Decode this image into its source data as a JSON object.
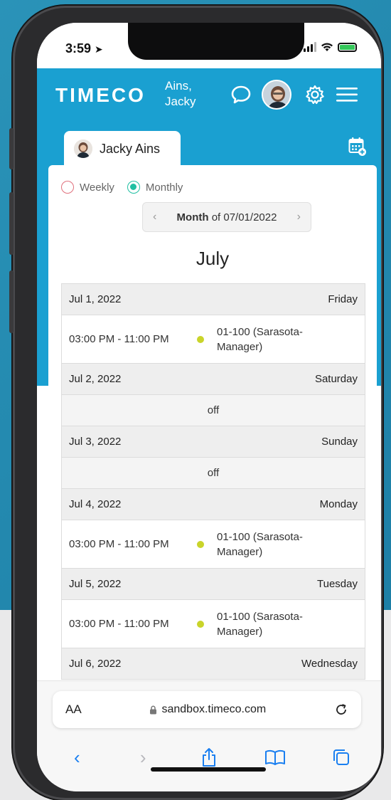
{
  "status": {
    "time": "3:59"
  },
  "header": {
    "logo": "TIMECO",
    "user_line1": "Ains,",
    "user_line2": "Jacky"
  },
  "tab": {
    "name": "Jacky Ains"
  },
  "view": {
    "weekly_label": "Weekly",
    "monthly_label": "Monthly",
    "selected": "Monthly"
  },
  "month_nav": {
    "bold": "Month",
    "rest": "of 07/01/2022"
  },
  "month_title": "July",
  "days": [
    {
      "date": "Jul 1, 2022",
      "weekday": "Friday",
      "time": "03:00 PM - 11:00 PM",
      "loc1": "01-100 (Sarasota-",
      "loc2": "Manager)"
    },
    {
      "date": "Jul 2, 2022",
      "weekday": "Saturday",
      "off": "off"
    },
    {
      "date": "Jul 3, 2022",
      "weekday": "Sunday",
      "off": "off"
    },
    {
      "date": "Jul 4, 2022",
      "weekday": "Monday",
      "time": "03:00 PM - 11:00 PM",
      "loc1": "01-100 (Sarasota-",
      "loc2": "Manager)"
    },
    {
      "date": "Jul 5, 2022",
      "weekday": "Tuesday",
      "time": "03:00 PM - 11:00 PM",
      "loc1": "01-100 (Sarasota-",
      "loc2": "Manager)"
    },
    {
      "date": "Jul 6, 2022",
      "weekday": "Wednesday"
    }
  ],
  "browser": {
    "aa": "AA",
    "url": "sandbox.timeco.com"
  },
  "colors": {
    "brand_blue": "#1aa0d1",
    "shift_dot": "#c9d42a",
    "radio_on": "#1fbfa2",
    "radio_off": "#e0707c",
    "ios_blue": "#1a7ff0"
  }
}
